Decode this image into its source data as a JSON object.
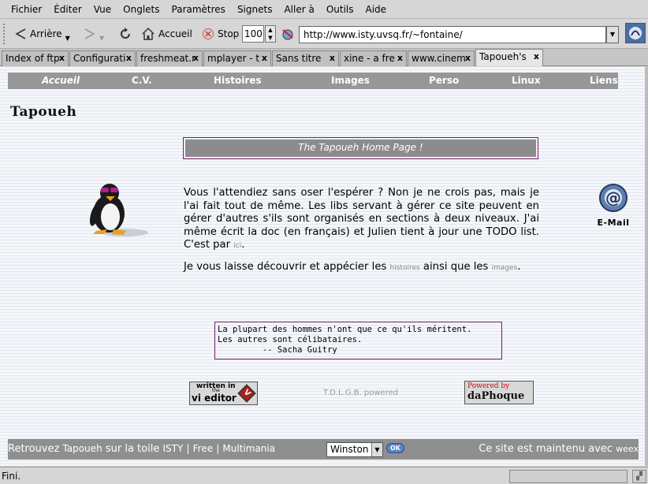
{
  "menubar": {
    "items": [
      "Fichier",
      "Éditer",
      "Vue",
      "Onglets",
      "Paramètres",
      "Signets",
      "Aller à",
      "Outils",
      "Aide"
    ]
  },
  "toolbar": {
    "back_label": "Arrière",
    "home_label": "Accueil",
    "stop_label": "Stop",
    "zoom_value": "100",
    "url": "http://www.isty.uvsq.fr/~fontaine/"
  },
  "tabs": [
    {
      "label": "Index of ftp",
      "active": false
    },
    {
      "label": "Configurati",
      "active": false
    },
    {
      "label": "freshmeat.r",
      "active": false
    },
    {
      "label": "mplayer - t",
      "active": false
    },
    {
      "label": "Sans titre",
      "active": false
    },
    {
      "label": "xine - a fre",
      "active": false
    },
    {
      "label": "www.cinem",
      "active": false
    },
    {
      "label": "Tapoueh's",
      "active": true
    }
  ],
  "tab_close_glyph": "x",
  "page": {
    "nav": [
      "Accueil",
      "C.V.",
      "Histoires",
      "Images",
      "Perso",
      "Linux",
      "Liens"
    ],
    "site_title": "Tapoueh",
    "banner": "The Tapoueh Home Page !",
    "email_label": "E-Mail",
    "intro_text": "Vous l'attendiez sans oser l'espérer ? Non je ne crois pas, mais je l'ai fait tout de même. Les libs servant à gérer ce site peuvent en gérer d'autres s'ils sont organisés en sections à deux niveaux. J'ai même écrit la doc (en français) et Julien tient à jour une TODO list. C'est par",
    "intro_link": "ici",
    "intro_end": ".",
    "discover_pre": "Je vous laisse découvrir et appécier les",
    "discover_link1": "histoires",
    "discover_mid": "ainsi que les",
    "discover_link2": "images",
    "discover_end": ".",
    "quote": "La plupart des hommes n'ont que ce qu'ils méritent.\nLes autres sont célibataires.\n         -- Sacha Guitry",
    "vi_badge": {
      "line1": "written in",
      "line2": "the",
      "line3": "vi editor"
    },
    "tdlgb": "T.D.L.G.B. powered",
    "phoque_badge": {
      "line1": "Powered by",
      "line2": "daPhoque"
    },
    "footer": {
      "retrouvez": "Retrouvez",
      "tapoueh": "Tapoueh",
      "sur_la_toile": "sur la toile",
      "isty": "ISTY",
      "sep1": "|",
      "free": "Free",
      "sep2": "|",
      "multimania": "Multimania",
      "theme_select": "Winston",
      "ok_label": "OK",
      "maintained": "Ce site est maintenu avec",
      "weex": "weex"
    }
  },
  "status": {
    "text": "Fini."
  }
}
